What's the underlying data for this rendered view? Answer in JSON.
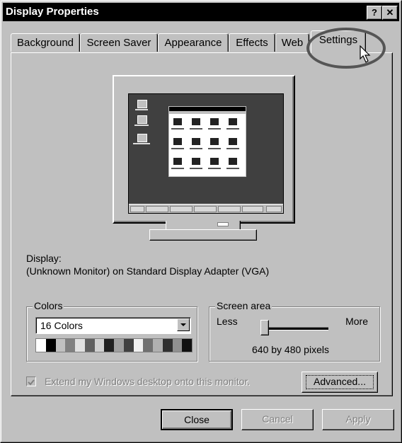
{
  "window": {
    "title": "Display Properties",
    "help_button": "?",
    "close_button": "✕"
  },
  "tabs": [
    {
      "label": "Background"
    },
    {
      "label": "Screen Saver"
    },
    {
      "label": "Appearance"
    },
    {
      "label": "Effects"
    },
    {
      "label": "Web"
    },
    {
      "label": "Settings",
      "active": true
    }
  ],
  "display": {
    "label": "Display:",
    "adapter": "(Unknown Monitor) on Standard Display Adapter (VGA)"
  },
  "colors": {
    "group_title": "Colors",
    "selected": "16 Colors",
    "palette": [
      "#ffffff",
      "#000000",
      "#c0c0c0",
      "#808080",
      "#e0e0e0",
      "#606060",
      "#d0d0d0",
      "#202020",
      "#a0a0a0",
      "#404040",
      "#f0f0f0",
      "#707070",
      "#b0b0b0",
      "#303030",
      "#909090",
      "#101010"
    ]
  },
  "screen_area": {
    "group_title": "Screen area",
    "less_label": "Less",
    "more_label": "More",
    "value_text": "640 by 480 pixels",
    "slider_level": 0
  },
  "extend_desktop": {
    "label": "Extend my Windows desktop onto this monitor.",
    "checked": true,
    "enabled": false
  },
  "buttons": {
    "advanced": "Advanced...",
    "close": "Close",
    "cancel": "Cancel",
    "apply": "Apply"
  }
}
